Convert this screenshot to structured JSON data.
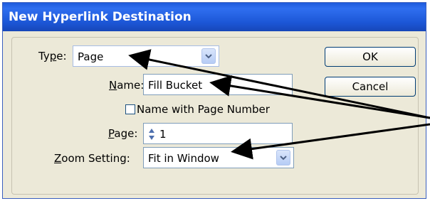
{
  "dialog": {
    "title": "New Hyperlink Destination",
    "type_label_prefix": "Ty",
    "type_label_u": "p",
    "type_label_suffix": "e:",
    "type_value": "Page",
    "name_label_u": "N",
    "name_label_suffix": "ame:",
    "name_value": "Fill Bucket",
    "checkbox_label": "Name with Page Number",
    "checkbox_checked": false,
    "page_label_u": "P",
    "page_label_suffix": "age:",
    "page_value": "1",
    "zoom_label_u": "Z",
    "zoom_label_suffix": "oom Setting:",
    "zoom_value": "Fit in Window",
    "ok_label": "OK",
    "cancel_label": "Cancel"
  },
  "colors": {
    "title_bar": "#1e5bdc",
    "dialog_bg": "#ece9d8",
    "arrow": "#000000"
  }
}
